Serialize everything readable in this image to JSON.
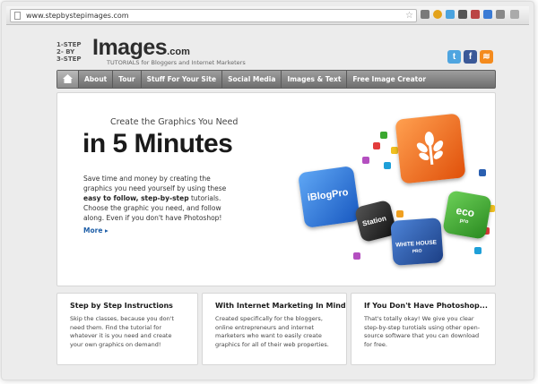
{
  "browser": {
    "url": "www.stepbystepimages.com"
  },
  "logo": {
    "steps": [
      "1-STEP",
      "2-  BY",
      "3-STEP"
    ],
    "main": "Images",
    "dotcom": ".com",
    "tagline": "TUTORIALS for Bloggers and Internet Marketers"
  },
  "social": [
    "twitter",
    "facebook",
    "rss"
  ],
  "nav": {
    "items": [
      "About",
      "Tour",
      "Stuff For Your Site",
      "Social Media",
      "Images & Text",
      "Free Image Creator"
    ]
  },
  "hero": {
    "subtitle": "Create the Graphics You Need",
    "title": "in 5 Minutes",
    "text_a": "Save time and money by creating the graphics you need yourself by using these ",
    "text_bold": "easy to follow, step-by-step",
    "text_b": " tutorials. Choose the graphic you need, and follow along. Even if you don't have Photoshop!",
    "more": "More ▸"
  },
  "graphics": {
    "tiles": [
      {
        "label": "iBlogPro",
        "color": "#1e6fd8"
      },
      {
        "label": "Station",
        "color": "#2a2a2a"
      },
      {
        "label": "",
        "color": "#ef6a0e"
      },
      {
        "label": "eco",
        "sublabel": "pro",
        "color": "#3aa82e"
      },
      {
        "label": "WHITE HOUSE",
        "sublabel": "PRO",
        "color": "#2a5fb0"
      }
    ]
  },
  "cards": [
    {
      "title": "Step by Step Instructions",
      "text": "Skip the classes, because you don't need them. Find the tutorial for whatever it is you need and create your own graphics on demand!"
    },
    {
      "title": "With Internet Marketing In Mind",
      "text": "Created specifically for the bloggers, online entrepreneurs and internet marketers who want to easily create graphics for all of their web properties."
    },
    {
      "title": "If You Don't Have Photoshop...",
      "text": "That's totally okay! We give you clear step-by-step turotials using other open-source software that you can download for free."
    }
  ]
}
